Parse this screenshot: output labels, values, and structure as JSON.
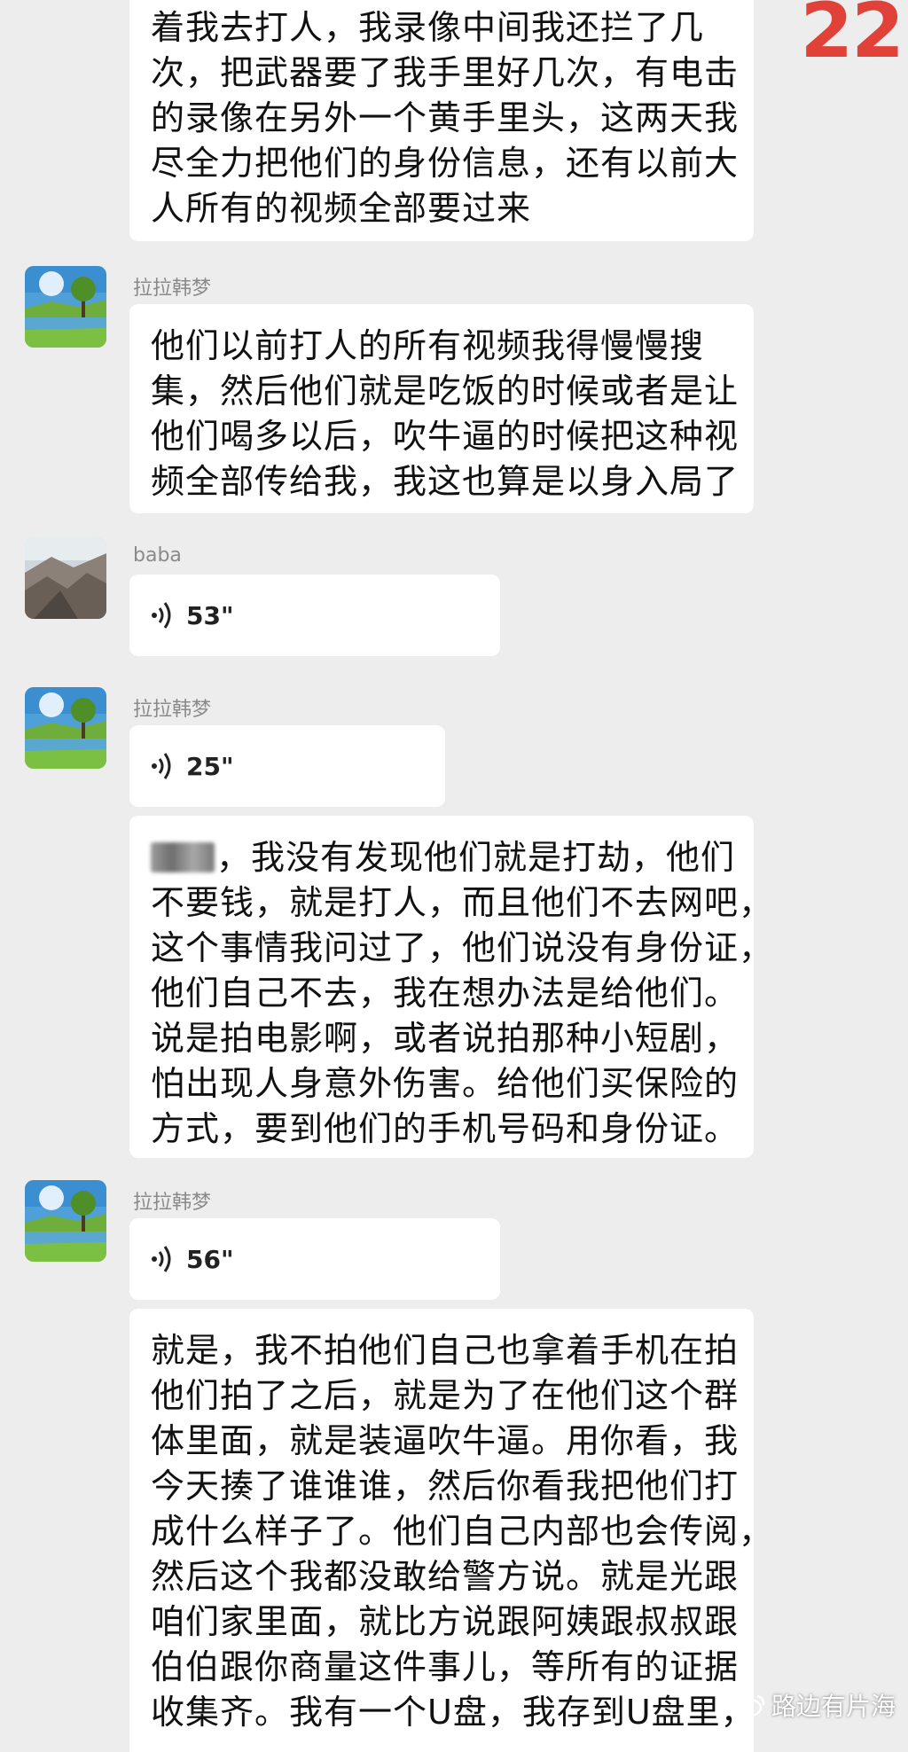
{
  "page_number": "22",
  "messages": [
    {
      "type": "text",
      "lines": [
        "着我去打人，我录像中间我还拦了几",
        "次，把武器要了我手里好几次，有电击",
        "的录像在另外一个黄手里头，这两天我",
        "尽全力把他们的身份信息，还有以前大",
        "人所有的视频全部要过来"
      ]
    },
    {
      "sender": "拉拉韩梦",
      "type": "text",
      "lines": [
        "他们以前打人的所有视频我得慢慢搜",
        "集，然后他们就是吃饭的时候或者是让",
        "他们喝多以后，吹牛逼的时候把这种视",
        "频全部传给我，我这也算是以身入局了"
      ]
    },
    {
      "sender": "baba",
      "type": "voice",
      "duration": "53\""
    },
    {
      "sender": "拉拉韩梦",
      "type": "voice",
      "duration": "25\""
    },
    {
      "type": "text",
      "first_line_after_redaction": "，我没有发现他们就是打劫，他们",
      "lines": [
        "不要钱，就是打人，而且他们不去网吧，",
        "这个事情我问过了，他们说没有身份证，",
        "他们自己不去，我在想办法是给他们。",
        "说是拍电影啊，或者说拍那种小短剧，",
        "怕出现人身意外伤害。给他们买保险的",
        "方式，要到他们的手机号码和身份证。"
      ]
    },
    {
      "sender": "拉拉韩梦",
      "type": "voice",
      "duration": "56\""
    },
    {
      "type": "text",
      "lines": [
        "就是，我不拍他们自己也拿着手机在拍",
        "他们拍了之后，就是为了在他们这个群",
        "体里面，就是装逼吹牛逼。用你看，我",
        "今天揍了谁谁谁，然后你看我把他们打",
        "成什么样子了。他们自己内部也会传阅，",
        "然后这个我都没敢给警方说。就是光跟",
        "咱们家里面，就比方说跟阿姨跟叔叔跟",
        "伯伯跟你商量这件事儿，等所有的证据",
        "收集齐。我有一个U盘，我存到U盘里，"
      ]
    }
  ],
  "watermark": "路边有片海",
  "icons": {
    "voice": "voice-wave-icon",
    "watermark": "weibo-logo-icon"
  },
  "colors": {
    "background": "#ededed",
    "bubble": "#ffffff",
    "page_number": "#e0423a"
  }
}
